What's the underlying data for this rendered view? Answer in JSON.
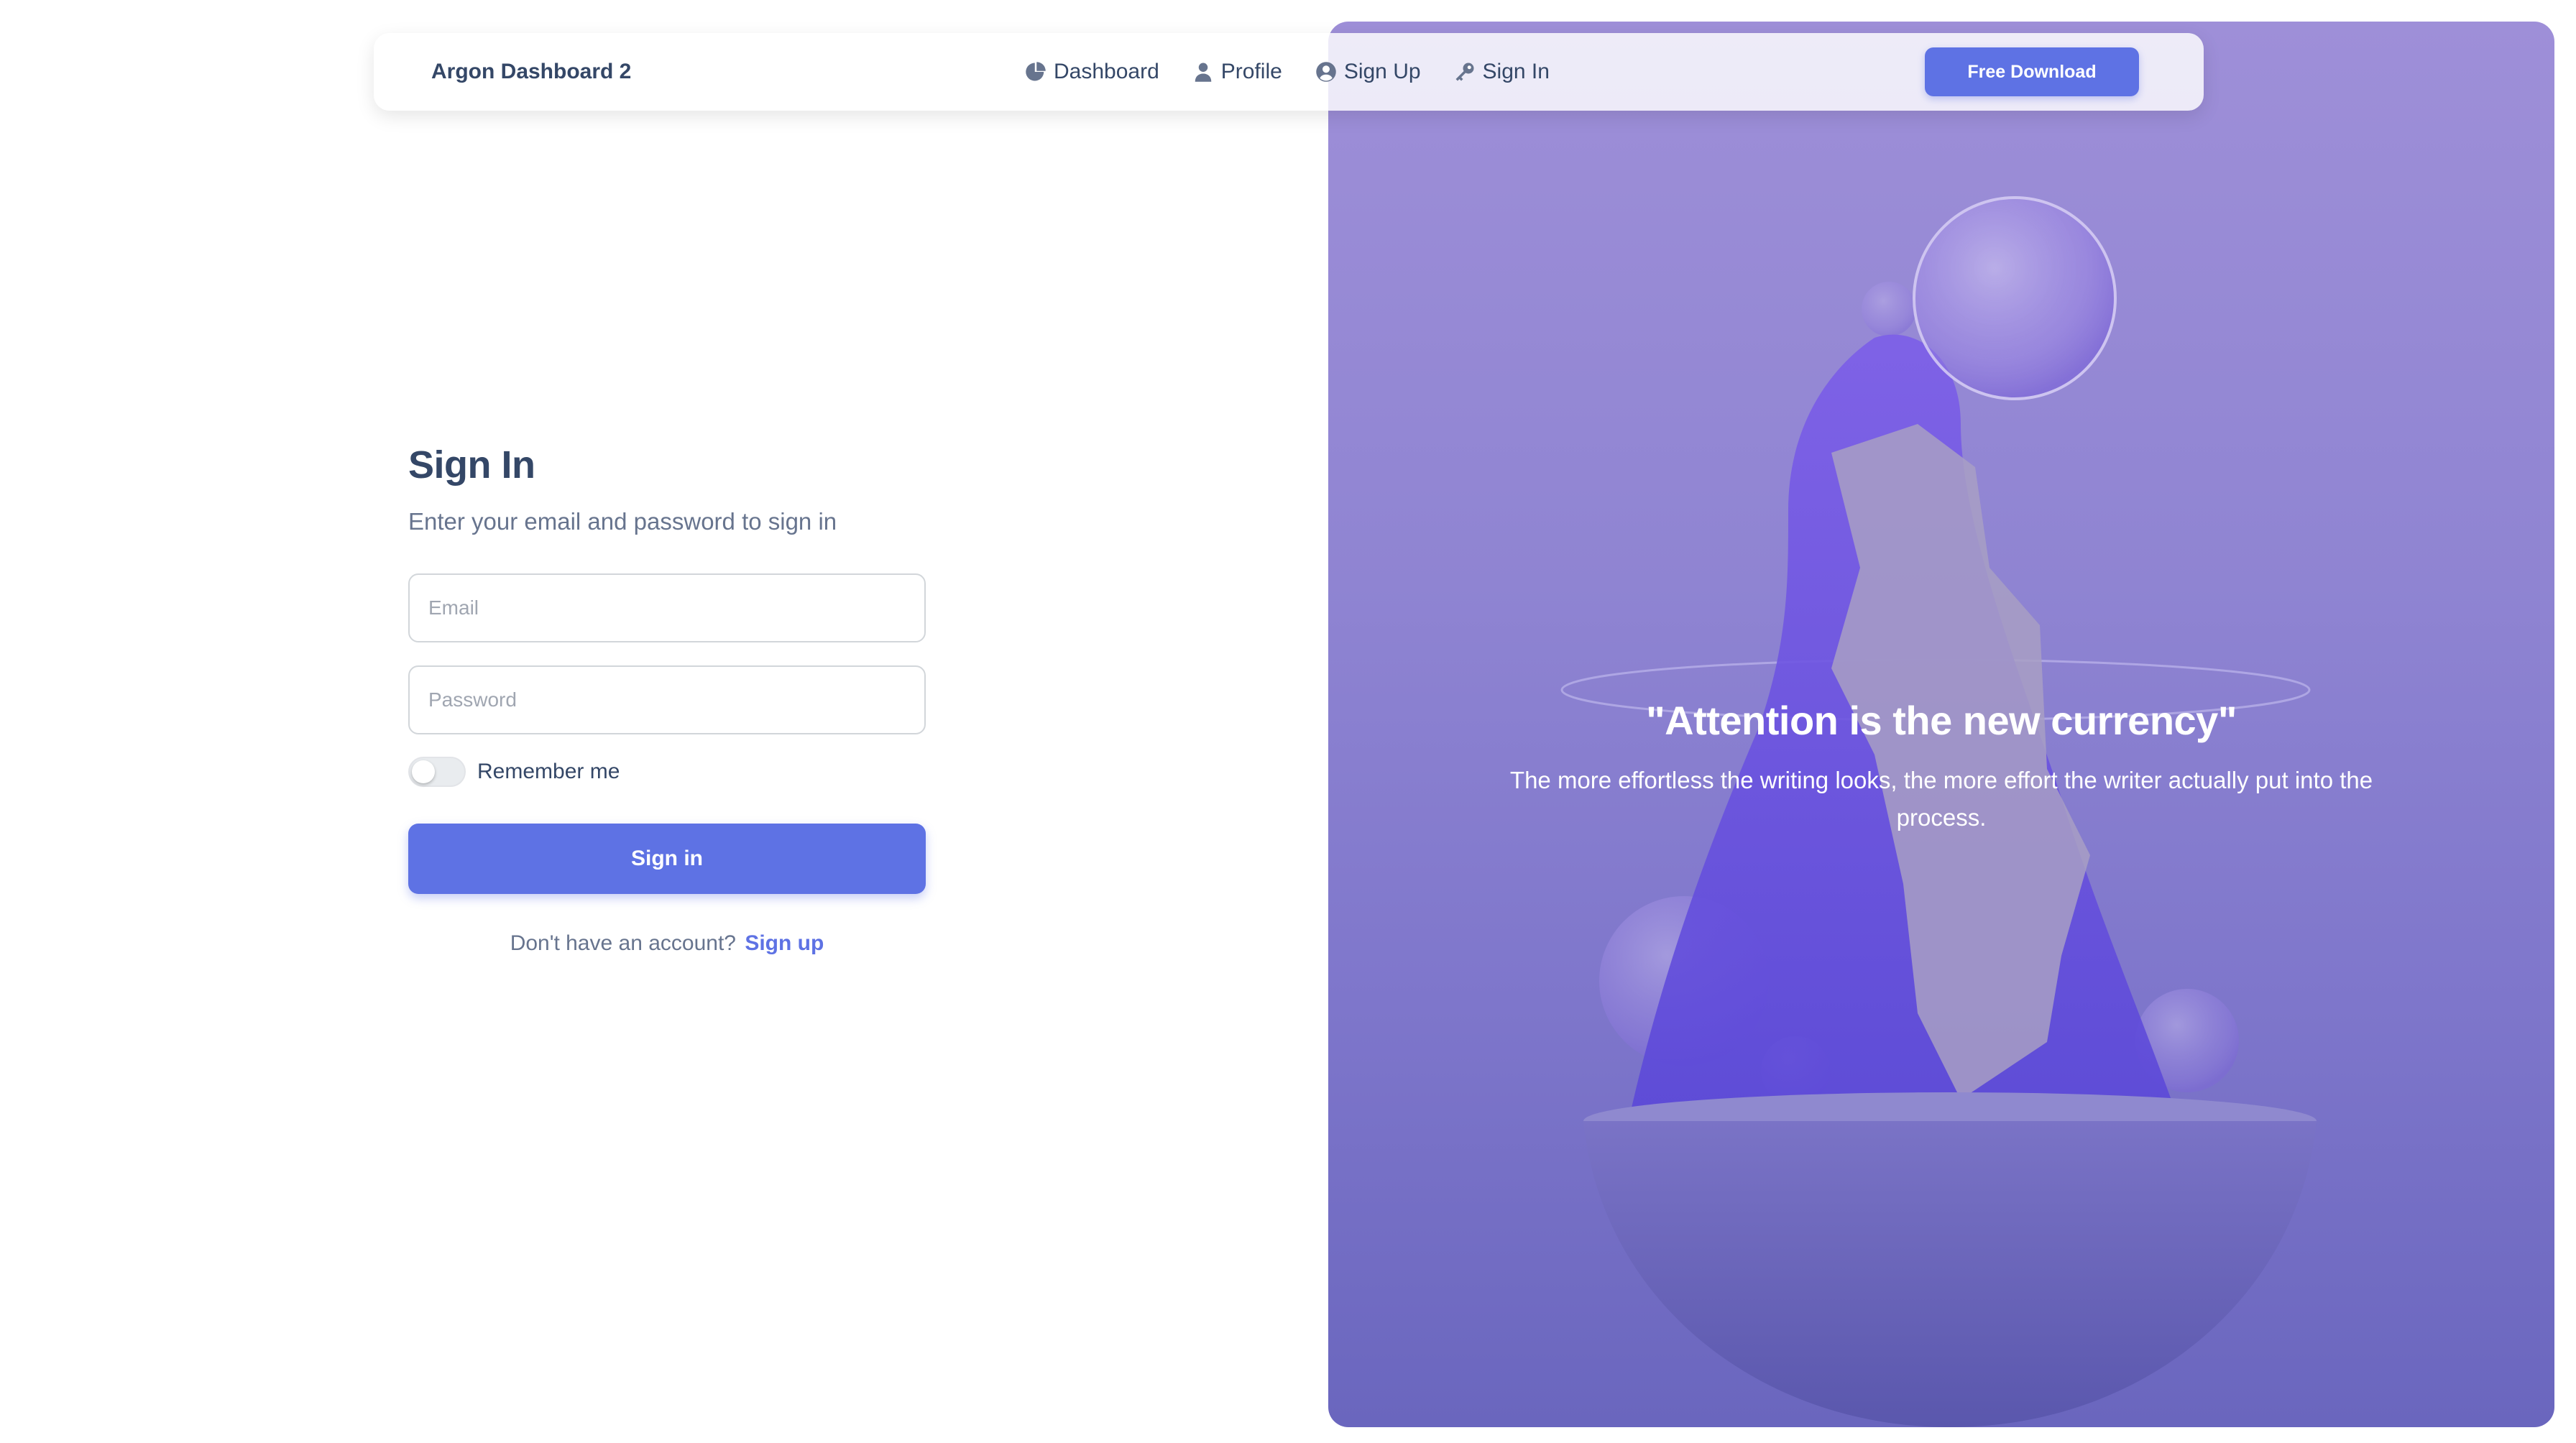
{
  "navbar": {
    "brand": "Argon Dashboard 2",
    "links": [
      {
        "label": "Dashboard",
        "icon": "pie-chart-icon"
      },
      {
        "label": "Profile",
        "icon": "user-icon"
      },
      {
        "label": "Sign Up",
        "icon": "user-circle-icon"
      },
      {
        "label": "Sign In",
        "icon": "key-icon"
      }
    ],
    "cta_label": "Free Download"
  },
  "signin": {
    "title": "Sign In",
    "subtitle": "Enter your email and password to sign in",
    "email_placeholder": "Email",
    "password_placeholder": "Password",
    "remember_label": "Remember me",
    "remember_checked": false,
    "submit_label": "Sign in",
    "no_account_text": "Don't have an account?",
    "signup_link": "Sign up"
  },
  "hero": {
    "quote": "\"Attention is the new currency\"",
    "text": "The more effortless the writing looks, the more effort the writer actually put into the process."
  },
  "colors": {
    "primary": "#5e72e4",
    "heading": "#344767",
    "muted": "#67748e",
    "hero_overlay": "#8f84d2"
  }
}
